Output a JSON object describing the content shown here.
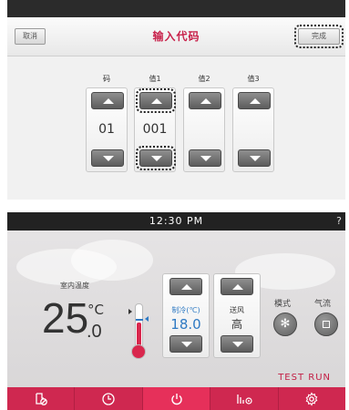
{
  "code_screen": {
    "cancel_label": "取消",
    "title": "输入代码",
    "done_label": "完成",
    "columns": [
      {
        "label": "码",
        "value": "01"
      },
      {
        "label": "值1",
        "value": "001"
      },
      {
        "label": "值2",
        "value": ""
      },
      {
        "label": "值3",
        "value": ""
      }
    ]
  },
  "main_screen": {
    "clock": "12:30 PM",
    "help": "?",
    "room_label": "室内温度",
    "room_temp_int": "25",
    "room_temp_dec": ".0",
    "room_temp_unit": "°C",
    "setpoint_label": "制冷(℃)",
    "setpoint_value": "18.0",
    "fan_label": "送风",
    "fan_value": "高",
    "mode_label": "模式",
    "airflow_label": "气流",
    "mode_icon": "snowflake-icon",
    "airflow_icon": "square-icon",
    "test_run": "TEST RUN",
    "nav": [
      "filter-icon",
      "clock-icon",
      "power-icon",
      "energy-icon",
      "settings-icon"
    ]
  },
  "colors": {
    "accent": "#cf2850",
    "title": "#c8224b",
    "setpoint_blue": "#2f7ac3"
  }
}
